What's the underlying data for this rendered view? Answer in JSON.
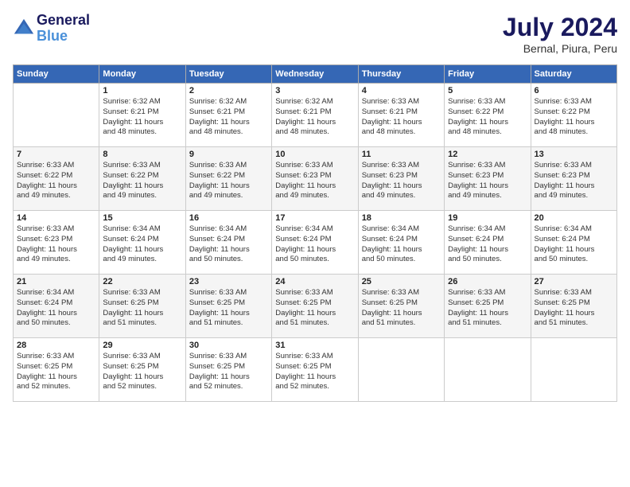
{
  "header": {
    "logo_line1": "General",
    "logo_line2": "Blue",
    "month": "July 2024",
    "location": "Bernal, Piura, Peru"
  },
  "weekdays": [
    "Sunday",
    "Monday",
    "Tuesday",
    "Wednesday",
    "Thursday",
    "Friday",
    "Saturday"
  ],
  "weeks": [
    [
      {
        "day": "",
        "info": ""
      },
      {
        "day": "1",
        "info": "Sunrise: 6:32 AM\nSunset: 6:21 PM\nDaylight: 11 hours\nand 48 minutes."
      },
      {
        "day": "2",
        "info": "Sunrise: 6:32 AM\nSunset: 6:21 PM\nDaylight: 11 hours\nand 48 minutes."
      },
      {
        "day": "3",
        "info": "Sunrise: 6:32 AM\nSunset: 6:21 PM\nDaylight: 11 hours\nand 48 minutes."
      },
      {
        "day": "4",
        "info": "Sunrise: 6:33 AM\nSunset: 6:21 PM\nDaylight: 11 hours\nand 48 minutes."
      },
      {
        "day": "5",
        "info": "Sunrise: 6:33 AM\nSunset: 6:22 PM\nDaylight: 11 hours\nand 48 minutes."
      },
      {
        "day": "6",
        "info": "Sunrise: 6:33 AM\nSunset: 6:22 PM\nDaylight: 11 hours\nand 48 minutes."
      }
    ],
    [
      {
        "day": "7",
        "info": "Sunrise: 6:33 AM\nSunset: 6:22 PM\nDaylight: 11 hours\nand 49 minutes."
      },
      {
        "day": "8",
        "info": "Sunrise: 6:33 AM\nSunset: 6:22 PM\nDaylight: 11 hours\nand 49 minutes."
      },
      {
        "day": "9",
        "info": "Sunrise: 6:33 AM\nSunset: 6:22 PM\nDaylight: 11 hours\nand 49 minutes."
      },
      {
        "day": "10",
        "info": "Sunrise: 6:33 AM\nSunset: 6:23 PM\nDaylight: 11 hours\nand 49 minutes."
      },
      {
        "day": "11",
        "info": "Sunrise: 6:33 AM\nSunset: 6:23 PM\nDaylight: 11 hours\nand 49 minutes."
      },
      {
        "day": "12",
        "info": "Sunrise: 6:33 AM\nSunset: 6:23 PM\nDaylight: 11 hours\nand 49 minutes."
      },
      {
        "day": "13",
        "info": "Sunrise: 6:33 AM\nSunset: 6:23 PM\nDaylight: 11 hours\nand 49 minutes."
      }
    ],
    [
      {
        "day": "14",
        "info": "Sunrise: 6:33 AM\nSunset: 6:23 PM\nDaylight: 11 hours\nand 49 minutes."
      },
      {
        "day": "15",
        "info": "Sunrise: 6:34 AM\nSunset: 6:24 PM\nDaylight: 11 hours\nand 49 minutes."
      },
      {
        "day": "16",
        "info": "Sunrise: 6:34 AM\nSunset: 6:24 PM\nDaylight: 11 hours\nand 50 minutes."
      },
      {
        "day": "17",
        "info": "Sunrise: 6:34 AM\nSunset: 6:24 PM\nDaylight: 11 hours\nand 50 minutes."
      },
      {
        "day": "18",
        "info": "Sunrise: 6:34 AM\nSunset: 6:24 PM\nDaylight: 11 hours\nand 50 minutes."
      },
      {
        "day": "19",
        "info": "Sunrise: 6:34 AM\nSunset: 6:24 PM\nDaylight: 11 hours\nand 50 minutes."
      },
      {
        "day": "20",
        "info": "Sunrise: 6:34 AM\nSunset: 6:24 PM\nDaylight: 11 hours\nand 50 minutes."
      }
    ],
    [
      {
        "day": "21",
        "info": "Sunrise: 6:34 AM\nSunset: 6:24 PM\nDaylight: 11 hours\nand 50 minutes."
      },
      {
        "day": "22",
        "info": "Sunrise: 6:33 AM\nSunset: 6:25 PM\nDaylight: 11 hours\nand 51 minutes."
      },
      {
        "day": "23",
        "info": "Sunrise: 6:33 AM\nSunset: 6:25 PM\nDaylight: 11 hours\nand 51 minutes."
      },
      {
        "day": "24",
        "info": "Sunrise: 6:33 AM\nSunset: 6:25 PM\nDaylight: 11 hours\nand 51 minutes."
      },
      {
        "day": "25",
        "info": "Sunrise: 6:33 AM\nSunset: 6:25 PM\nDaylight: 11 hours\nand 51 minutes."
      },
      {
        "day": "26",
        "info": "Sunrise: 6:33 AM\nSunset: 6:25 PM\nDaylight: 11 hours\nand 51 minutes."
      },
      {
        "day": "27",
        "info": "Sunrise: 6:33 AM\nSunset: 6:25 PM\nDaylight: 11 hours\nand 51 minutes."
      }
    ],
    [
      {
        "day": "28",
        "info": "Sunrise: 6:33 AM\nSunset: 6:25 PM\nDaylight: 11 hours\nand 52 minutes."
      },
      {
        "day": "29",
        "info": "Sunrise: 6:33 AM\nSunset: 6:25 PM\nDaylight: 11 hours\nand 52 minutes."
      },
      {
        "day": "30",
        "info": "Sunrise: 6:33 AM\nSunset: 6:25 PM\nDaylight: 11 hours\nand 52 minutes."
      },
      {
        "day": "31",
        "info": "Sunrise: 6:33 AM\nSunset: 6:25 PM\nDaylight: 11 hours\nand 52 minutes."
      },
      {
        "day": "",
        "info": ""
      },
      {
        "day": "",
        "info": ""
      },
      {
        "day": "",
        "info": ""
      }
    ]
  ]
}
